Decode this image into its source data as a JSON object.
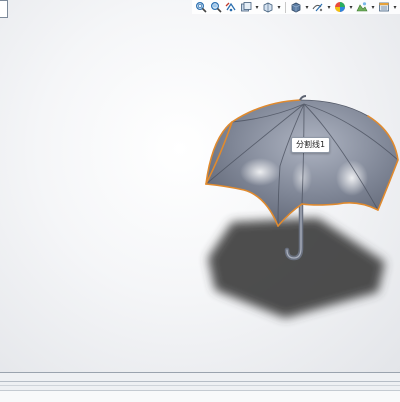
{
  "viewport": {
    "feature_tooltip": "分割线1"
  },
  "heads_up_toolbar": {
    "buttons": [
      {
        "icon": "zoom-to-fit-icon"
      },
      {
        "icon": "zoom-to-area-icon"
      },
      {
        "icon": "previous-view-icon"
      },
      {
        "icon": "section-view-icon",
        "dropdown": true
      },
      {
        "icon": "view-orientation-icon",
        "dropdown": true
      },
      {
        "icon": "display-style-icon",
        "dropdown": true
      },
      {
        "icon": "hide-show-items-icon",
        "dropdown": true
      },
      {
        "icon": "edit-appearance-icon",
        "dropdown": true
      },
      {
        "icon": "apply-scene-icon",
        "dropdown": true
      },
      {
        "icon": "view-settings-icon",
        "dropdown": true
      }
    ]
  },
  "colors": {
    "umbrella_canopy": "#7f8696",
    "canopy_highlight": "#d8dce6",
    "edge_highlight": "#e08a2e",
    "shadow": "#3a3a3a",
    "background_top": "#ffffff",
    "background_bottom": "#dcdfe3"
  }
}
